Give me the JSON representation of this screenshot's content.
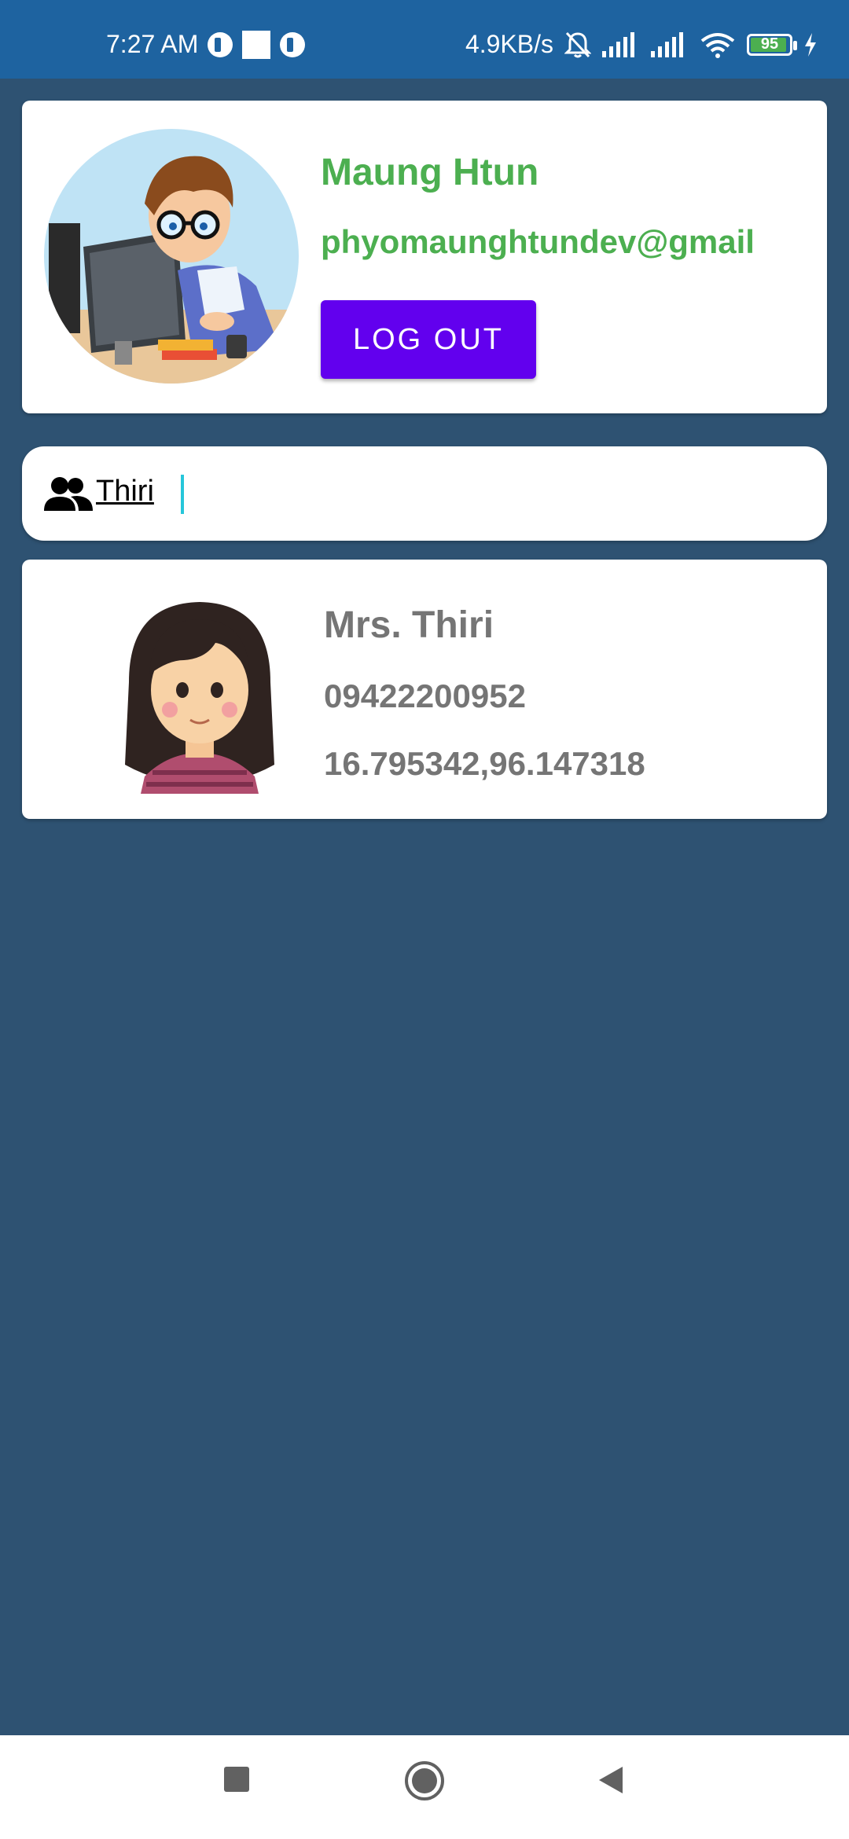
{
  "status_bar": {
    "time": "7:27 AM",
    "net_speed": "4.9KB/s",
    "battery_level": "95",
    "battery_fraction": 0.95,
    "icons": [
      "app-notification-icon",
      "square-notification-icon",
      "app-notification-icon",
      "bell-off-icon",
      "signal-icon",
      "signal-icon",
      "wifi-icon",
      "battery-icon",
      "charging-icon"
    ]
  },
  "profile": {
    "name": "Maung Htun",
    "email": "phyomaunghtundev@gmail",
    "logout_label": "LOG OUT"
  },
  "search": {
    "icon": "people-icon",
    "value": "Thiri"
  },
  "contacts": [
    {
      "name": "Mrs. Thiri",
      "phone": "09422200952",
      "coords": "16.795342,96.147318"
    }
  ],
  "nav": {
    "icons": [
      "recents-square-icon",
      "home-circle-icon",
      "back-triangle-icon"
    ]
  },
  "colors": {
    "background": "#2e5272",
    "status_bar": "#1e63a0",
    "accent_green": "#4caf50",
    "button_purple": "#6200ee",
    "caret": "#26c6da",
    "contact_text": "#757575"
  }
}
